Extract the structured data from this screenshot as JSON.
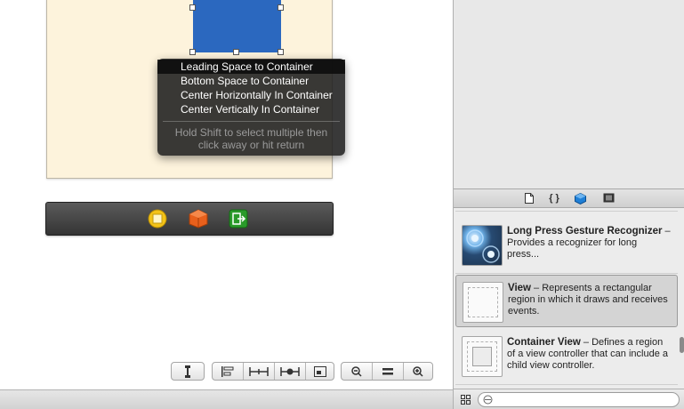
{
  "constraint_menu": {
    "items": [
      {
        "label": "Leading Space to Container"
      },
      {
        "label": "Bottom Space to Container"
      },
      {
        "label": "Center Horizontally In Container"
      },
      {
        "label": "Center Vertically In Container"
      }
    ],
    "hint_line1": "Hold Shift to select multiple then",
    "hint_line2": "click away or hit return"
  },
  "library_tabs": {
    "file_template": "file-icon",
    "code_snippet": "{ }",
    "object": "cube-icon",
    "media": "film-icon"
  },
  "library_items": [
    {
      "title": "Long Press Gesture Recognizer",
      "desc": " – Provides a recognizer for long press..."
    },
    {
      "title": "View",
      "desc": " – Represents a rectangular region in which it draws and receives events."
    },
    {
      "title": "Container View",
      "desc": " – Defines a region of a view controller that can include a child view controller."
    }
  ],
  "filter": {
    "placeholder": "",
    "value": ""
  },
  "colors": {
    "canvas_background": "#fdf3dc",
    "selected_view": "#2b68bf",
    "menu_background": "#1e1e1e",
    "dock_background": "#3f3f3f"
  }
}
